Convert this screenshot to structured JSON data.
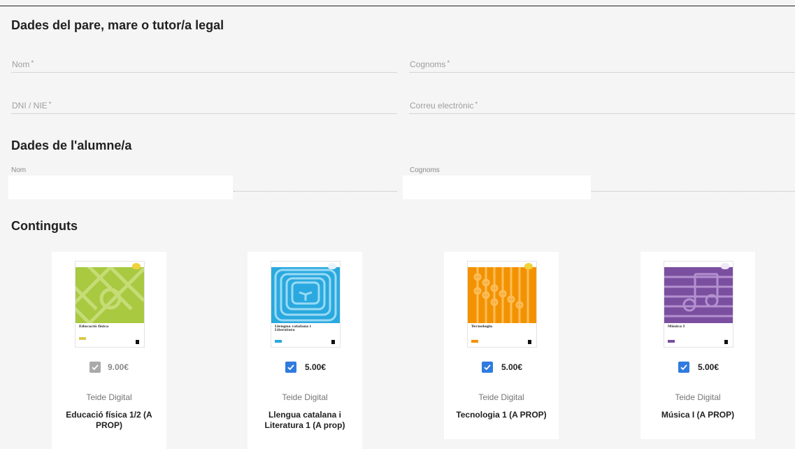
{
  "sections": {
    "parent_title": "Dades del pare, mare o tutor/a legal",
    "student_title": "Dades de l'alumne/a",
    "contents_title": "Continguts"
  },
  "parent_fields": {
    "nom": "Nom",
    "cognoms": "Cognoms",
    "dni": "DNI / NIE",
    "email": "Correu electrònic",
    "required_mark": "*"
  },
  "student_fields": {
    "nom_label": "Nom",
    "cognoms_label": "Cognoms",
    "nom_value": "",
    "cognoms_value": ""
  },
  "products": [
    {
      "price": "9.00€",
      "checked": true,
      "disabled": true,
      "publisher": "Teide Digital",
      "title": "Educació física 1/2 (A PROP)",
      "cover_title": "Educació física",
      "cover_color": "#a8c940"
    },
    {
      "price": "5.00€",
      "checked": true,
      "disabled": false,
      "publisher": "Teide Digital",
      "title": "Llengua catalana i Literatura 1 (A prop)",
      "cover_title": "Llengua catalana i Literatura",
      "cover_color": "#29a9df"
    },
    {
      "price": "5.00€",
      "checked": true,
      "disabled": false,
      "publisher": "Teide Digital",
      "title": "Tecnologia 1 (A PROP)",
      "cover_title": "Tecnologia",
      "cover_color": "#f39200"
    },
    {
      "price": "5.00€",
      "checked": true,
      "disabled": false,
      "publisher": "Teide Digital",
      "title": "Música I (A PROP)",
      "cover_title": "Música I",
      "cover_color": "#7b4fa0"
    }
  ],
  "colors": {
    "checkbox_checked": "#2f7bdf",
    "checkbox_disabled": "#a9a9a9",
    "price_active": "#212121",
    "price_disabled": "#8a8a8a"
  }
}
